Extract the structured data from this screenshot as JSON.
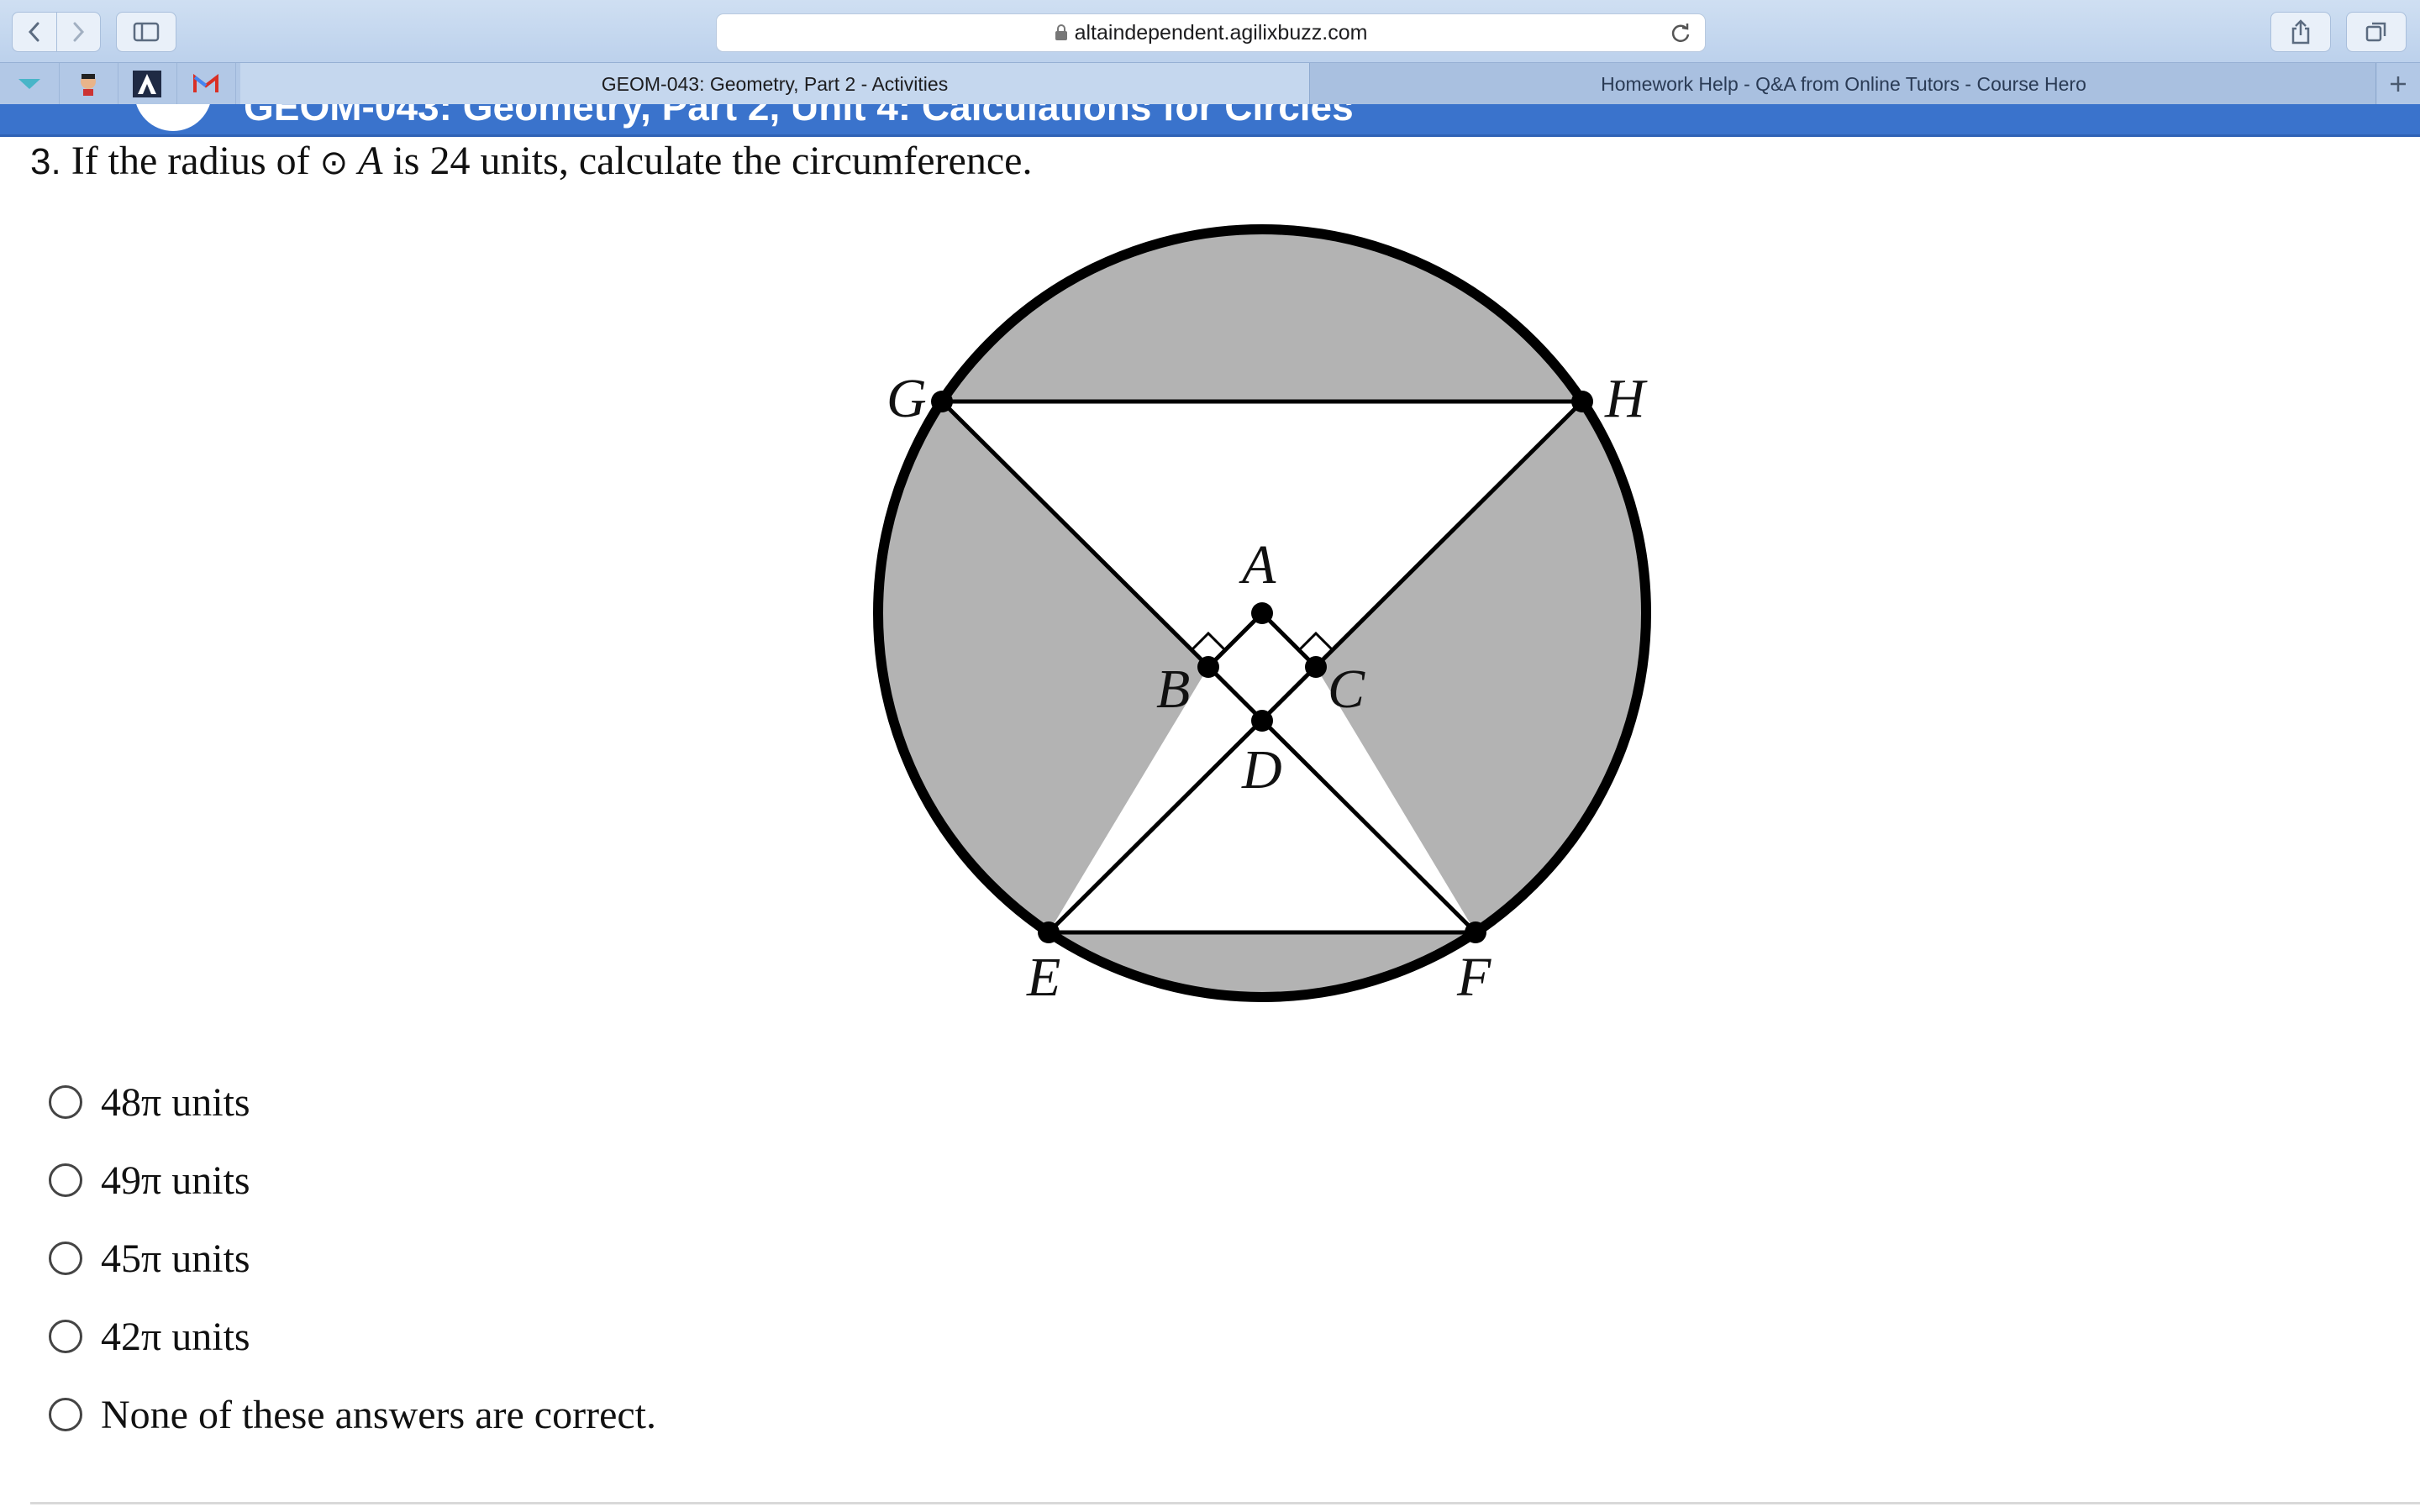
{
  "browser": {
    "url": "altaindependent.agilixbuzz.com",
    "tabs": [
      {
        "title": "GEOM-043: Geometry, Part 2 - Activities",
        "active": true
      },
      {
        "title": "Homework Help - Q&A from Online Tutors - Course Hero",
        "active": false
      }
    ],
    "pinned_tabs": [
      "pinned-tab-1",
      "pinned-tab-2",
      "pinned-tab-3",
      "pinned-tab-4"
    ]
  },
  "page": {
    "header_title": "GEOM-043: Geometry, Part 2, Unit 4: Calculations for Circles"
  },
  "question": {
    "number": "3.",
    "text_before": "If the radius of",
    "circle_symbol": "⊙",
    "variable": "A",
    "text_after": "is 24 units, calculate the circumference."
  },
  "diagram": {
    "labels": {
      "A": "A",
      "B": "B",
      "C": "C",
      "D": "D",
      "E": "E",
      "F": "F",
      "G": "G",
      "H": "H"
    },
    "shade_color": "#b3b3b3",
    "line_color": "#000000"
  },
  "answers": [
    {
      "label": "48π units",
      "selected": false
    },
    {
      "label": "49π units",
      "selected": false
    },
    {
      "label": "45π units",
      "selected": false
    },
    {
      "label": "42π units",
      "selected": false
    },
    {
      "label": "None of these answers are correct.",
      "selected": false
    }
  ]
}
